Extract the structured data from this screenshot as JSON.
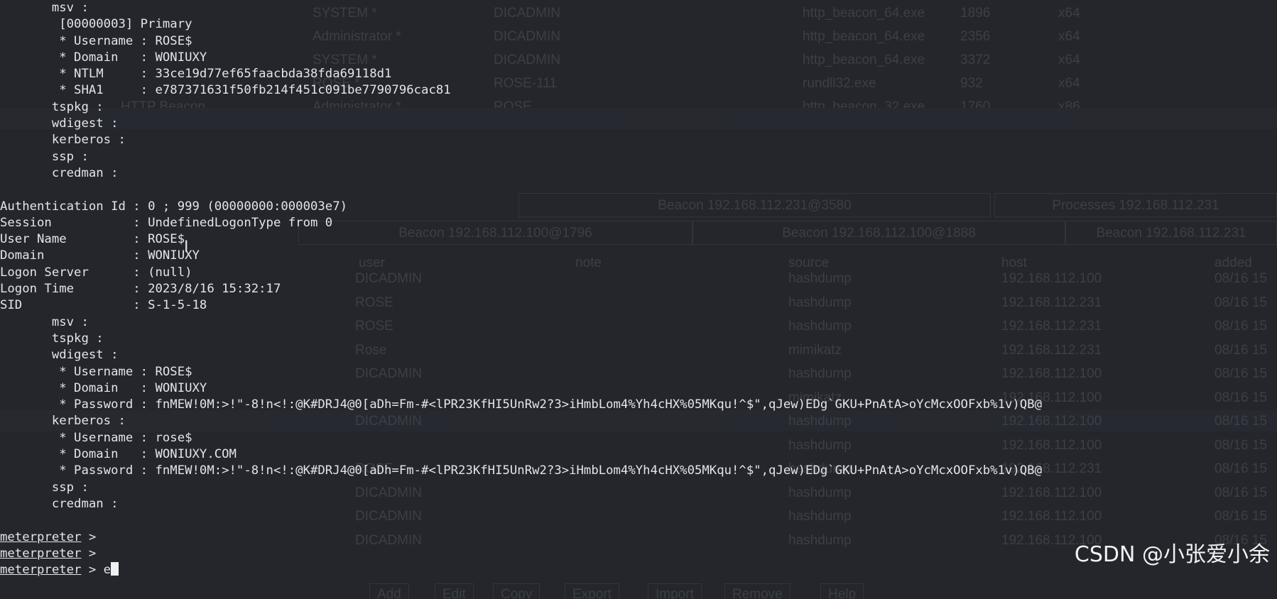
{
  "terminal": {
    "lines": [
      "       msv :",
      "        [00000003] Primary",
      "        * Username : ROSE$",
      "        * Domain   : WONIUXY",
      "        * NTLM     : 33ce19d77ef65faacbda38fda69118d1",
      "        * SHA1     : e787371631f50fb214f451c091be7790796cac81",
      "       tspkg :",
      "       wdigest :",
      "       kerberos :",
      "       ssp :",
      "       credman :",
      "",
      "Authentication Id : 0 ; 999 (00000000:000003e7)",
      "Session           : UndefinedLogonType from 0",
      "User Name         : ROSE$",
      "Domain            : WONIUXY",
      "Logon Server      : (null)",
      "Logon Time        : 2023/8/16 15:32:17",
      "SID               : S-1-5-18",
      "       msv :",
      "       tspkg :",
      "       wdigest :",
      "        * Username : ROSE$",
      "        * Domain   : WONIUXY",
      "        * Password : fnMEW!0M:>!\"-8!n<!:@K#DRJ4@0[aDh=Fm-#<lPR23KfHI5UnRw2?3>iHmbLom4%Yh4cHX%05MKqu!^$\",qJew)EDg`GKU+PnAtA>oYcMcxOOFxb%1v)QB@",
      "       kerberos :",
      "        * Username : rose$",
      "        * Domain   : WONIUXY.COM",
      "        * Password : fnMEW!0M:>!\"-8!n<!:@K#DRJ4@0[aDh=Fm-#<lPR23KfHI5UnRw2?3>iHmbLom4%Yh4cHX%05MKqu!^$\",qJew)EDg`GKU+PnAtA>oYcMcxOOFxb%1v)QB@",
      "       ssp :",
      "       credman :",
      ""
    ],
    "prompts": [
      {
        "label": "meterpreter",
        "suffix": " >",
        "input": ""
      },
      {
        "label": "meterpreter",
        "suffix": " >",
        "input": ""
      },
      {
        "label": "meterpreter",
        "suffix": " > ",
        "input": "e"
      }
    ]
  },
  "watermark": "CSDN @小张爱小余",
  "background_window": {
    "process_rows": [
      [
        "SYSTEM *",
        "DICADMIN",
        "http_beacon_64.exe",
        "1896",
        "x64"
      ],
      [
        "Administrator *",
        "DICADMIN",
        "http_beacon_64.exe",
        "2356",
        "x64"
      ],
      [
        "SYSTEM *",
        "DICADMIN",
        "http_beacon_64.exe",
        "3372",
        "x64"
      ],
      [
        "ROSE *",
        "ROSE-111",
        "rundll32.exe",
        "932",
        "x64"
      ],
      [
        "HTTP Beacon",
        "Administrator *",
        "ROSE",
        "http_beacon_32.exe",
        "1760",
        "x86"
      ]
    ],
    "tabs_row1": [
      "Beacon 192.168.112.231@3580",
      "Processes 192.168.112.231"
    ],
    "tabs_row2": [
      "Beacon 192.168.112.100@1796",
      "Beacon 192.168.112.100@1888",
      "Beacon 192.168.112.231"
    ],
    "columns": [
      "user",
      "note",
      "source",
      "host",
      "added"
    ],
    "cred_rows": [
      [
        "DICADMIN",
        "hashdump",
        "192.168.112.100",
        "08/16 15"
      ],
      [
        "ROSE",
        "hashdump",
        "192.168.112.231",
        "08/16 15"
      ],
      [
        "ROSE",
        "hashdump",
        "192.168.112.231",
        "08/16 15"
      ],
      [
        "Rose",
        "mimikatz",
        "192.168.112.231",
        "08/16 15"
      ],
      [
        "DICADMIN",
        "hashdump",
        "192.168.112.100",
        "08/16 15"
      ],
      [
        "",
        "mimikatz",
        "192.168.112.100",
        "08/16 15"
      ],
      [
        "DICADMIN",
        "hashdump",
        "192.168.112.100",
        "08/16 15"
      ],
      [
        "",
        "hashdump",
        "192.168.112.100",
        "08/16 15"
      ],
      [
        "ROSE",
        "hashdump",
        "192.168.112.231",
        "08/16 15"
      ],
      [
        "DICADMIN",
        "hashdump",
        "192.168.112.100",
        "08/16 15"
      ],
      [
        "DICADMIN",
        "hashdump",
        "192.168.112.100",
        "08/16 15"
      ],
      [
        "DICADMIN",
        "hashdump",
        "192.168.112.100",
        "08/16 15"
      ]
    ],
    "buttons": [
      "Add",
      "Edit",
      "Copy",
      "Export",
      "Import",
      "Remove",
      "Help"
    ]
  }
}
